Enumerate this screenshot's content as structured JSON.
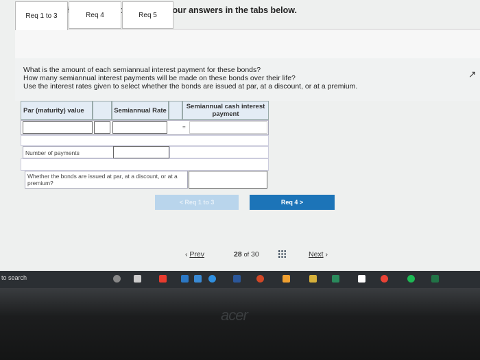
{
  "instruction": "Complete this question by entering your answers in the tabs below.",
  "tabs": [
    {
      "label": "Req 1 to 3"
    },
    {
      "label": "Req 4"
    },
    {
      "label": "Req 5"
    }
  ],
  "question": {
    "line1": "What is the amount of each semiannual interest payment for these bonds?",
    "line2": "How many semiannual interest payments will be made on these bonds over their life?",
    "line3": "Use the interest rates given to select whether the bonds are issued at par, at a discount, or at a premium."
  },
  "table": {
    "col1": "Par (maturity) value",
    "col2": "Semiannual Rate",
    "col3": "Semiannual cash interest payment",
    "eq": "=",
    "num_payments_label": "Number of payments",
    "par_discount_label": "Whether the bonds are issued at par, at a discount, or at a premium?"
  },
  "buttons": {
    "prev": "< Req 1 to 3",
    "next": "Req 4  >"
  },
  "pagination": {
    "prev": "Prev",
    "page": "28",
    "of": "of",
    "total": "30",
    "next": "Next"
  },
  "taskbar": {
    "search": "to search"
  },
  "brand": "acer"
}
